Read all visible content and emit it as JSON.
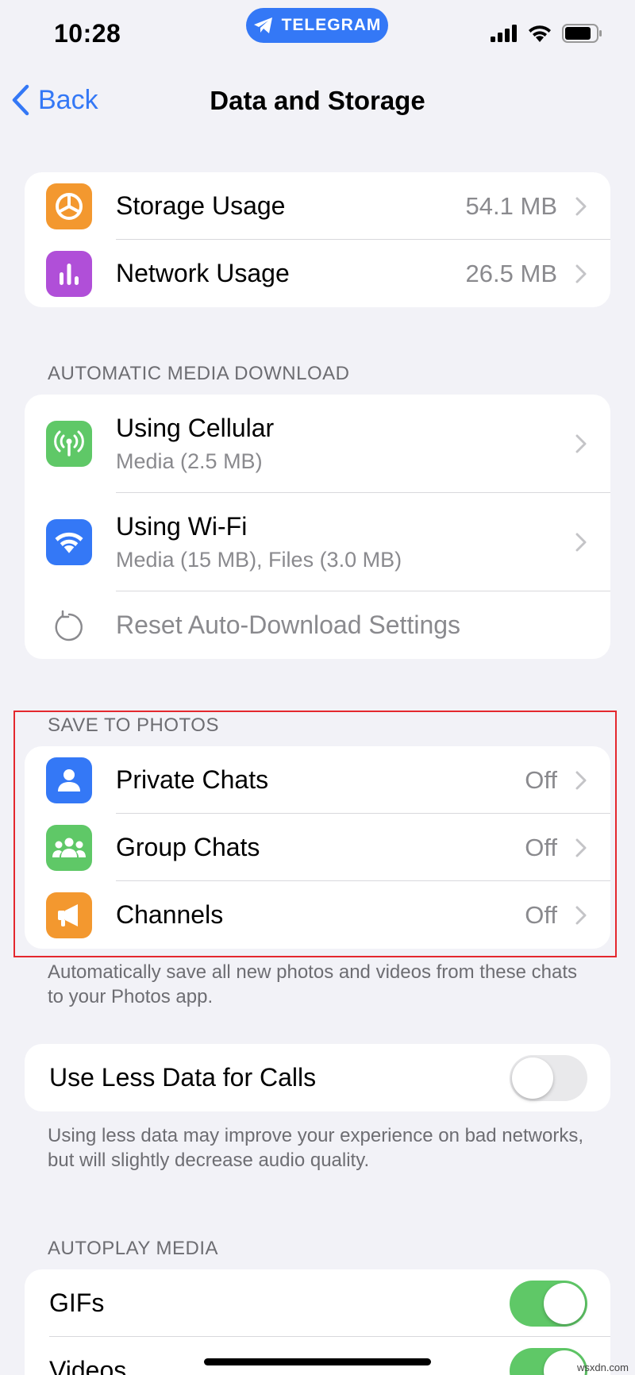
{
  "status_bar": {
    "time": "10:28",
    "pill_label": "TELEGRAM"
  },
  "nav": {
    "back_label": "Back",
    "title": "Data and Storage"
  },
  "usage": {
    "items": [
      {
        "label": "Storage Usage",
        "value": "54.1 MB",
        "icon": "pie-chart-icon",
        "color": "#f3982f"
      },
      {
        "label": "Network Usage",
        "value": "26.5 MB",
        "icon": "bar-chart-icon",
        "color": "#b04fd8"
      }
    ]
  },
  "auto_download": {
    "header": "AUTOMATIC MEDIA DOWNLOAD",
    "items": [
      {
        "label": "Using Cellular",
        "sub": "Media (2.5 MB)",
        "icon": "antenna-icon",
        "color": "#5fc867"
      },
      {
        "label": "Using Wi-Fi",
        "sub": "Media (15 MB), Files (3.0 MB)",
        "icon": "wifi-icon",
        "color": "#3478f6"
      }
    ],
    "reset_label": "Reset Auto-Download Settings"
  },
  "save_to_photos": {
    "header": "SAVE TO PHOTOS",
    "items": [
      {
        "label": "Private Chats",
        "value": "Off",
        "icon": "person-icon",
        "color": "#3478f6"
      },
      {
        "label": "Group Chats",
        "value": "Off",
        "icon": "group-icon",
        "color": "#5fc867"
      },
      {
        "label": "Channels",
        "value": "Off",
        "icon": "megaphone-icon",
        "color": "#f3982f"
      }
    ],
    "footer": "Automatically save all new photos and videos from these chats to your Photos app."
  },
  "calls": {
    "label": "Use Less Data for Calls",
    "enabled": false,
    "footer": "Using less data may improve your experience on bad networks, but will slightly decrease audio quality."
  },
  "autoplay": {
    "header": "AUTOPLAY MEDIA",
    "items": [
      {
        "label": "GIFs",
        "enabled": true
      },
      {
        "label": "Videos",
        "enabled": true
      }
    ]
  },
  "watermark": "wsxdn.com"
}
